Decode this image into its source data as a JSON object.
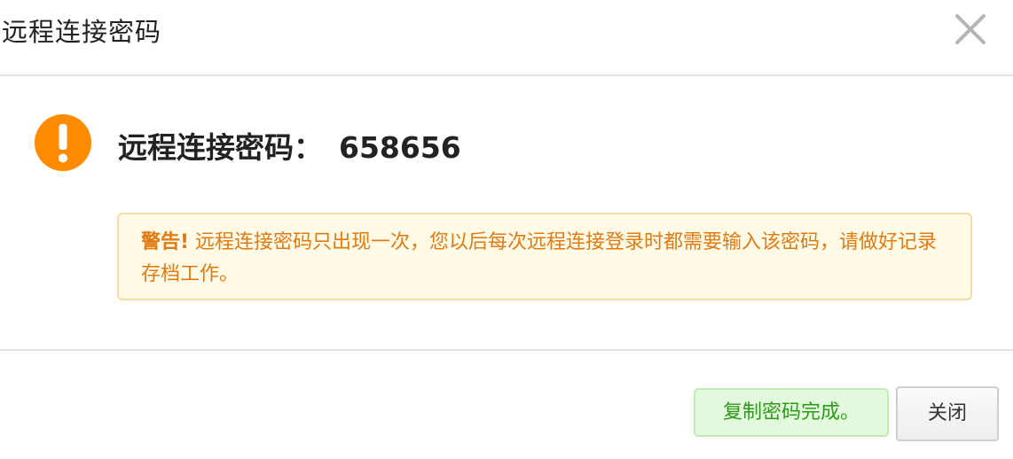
{
  "dialog": {
    "title": "远程连接密码",
    "close_icon": "close-x-icon"
  },
  "content": {
    "warning_icon": "exclamation-circle-icon",
    "warning_icon_color": "#ff8c00",
    "password_label": "远程连接密码：",
    "password_value": "658656",
    "alert": {
      "strong": "警告!",
      "text": " 远程连接密码只出现一次，您以后每次远程连接登录时都需要输入该密码，请做好记录存档工作。"
    }
  },
  "footer": {
    "copied_status": "复制密码完成。",
    "close_label": "关闭"
  },
  "colors": {
    "alert_text": "#e07b14",
    "alert_bg": "#fffbe6",
    "success_text": "#2e9a1a",
    "success_bg": "#e3f9dd"
  }
}
